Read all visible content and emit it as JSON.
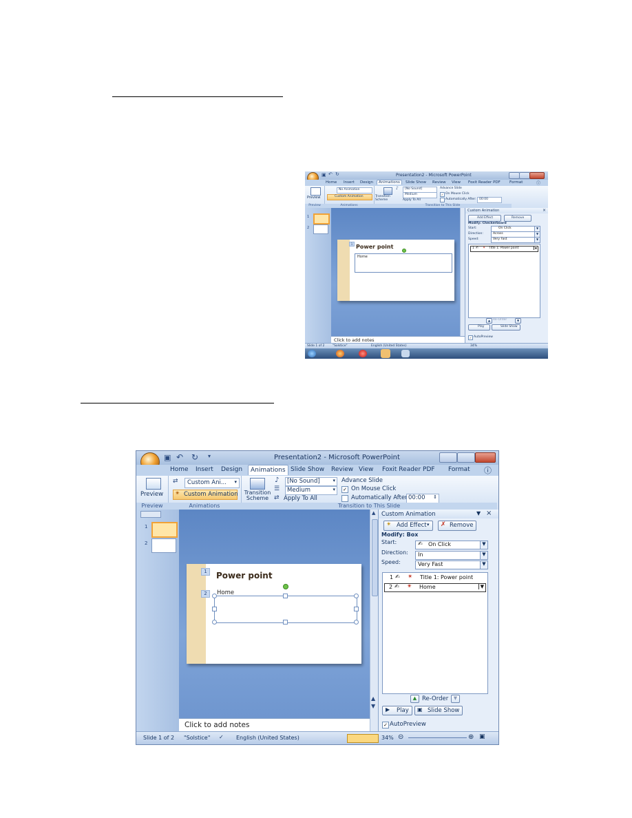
{
  "figure1": {
    "window_title": "Presentation2 - Microsoft PowerPoint",
    "tabs": [
      "Home",
      "Insert",
      "Design",
      "Animations",
      "Slide Show",
      "Review",
      "View",
      "Foxit Reader PDF",
      "Format"
    ],
    "active_tab": "Animations",
    "ribbon": {
      "preview_label": "Preview",
      "animate_value": "No Animation",
      "custom_animation_label": "Custom Animation",
      "transition_scheme_label": "Transition Scheme",
      "sound_value": "[No Sound]",
      "speed_value": "Medium",
      "apply_to_all_label": "Apply To All",
      "advance_slide_label": "Advance Slide",
      "on_mouse_click_label": "On Mouse Click",
      "auto_after_label": "Automatically After:",
      "auto_after_value": "00:00",
      "groups": [
        "Preview",
        "Animations",
        "Transition to This Slide"
      ]
    },
    "thumb_numbers": [
      "1",
      "2"
    ],
    "slide": {
      "title": "Power point",
      "body": "Home",
      "tag": "1"
    },
    "notes_placeholder": "Click to add notes",
    "task_pane": {
      "title": "Custom Animation",
      "add_effect_label": "Add Effect",
      "remove_label": "Remove",
      "modify_label": "Modify: Checkerboard",
      "start_label": "Start:",
      "start_value": "On Click",
      "direction_label": "Direction:",
      "direction_value": "Across",
      "speed_label": "Speed:",
      "speed_value": "Very Fast",
      "list": [
        {
          "num": "1",
          "text": "Title 1: Power point"
        }
      ],
      "reorder_label": "Re-Order",
      "play_label": "Play",
      "slideshow_label": "Slide Show",
      "autopreview_label": "AutoPreview"
    },
    "status": {
      "slide": "Slide 1 of 2",
      "theme": "\"Solstice\"",
      "language": "English (United States)",
      "zoom": "34%"
    }
  },
  "figure2": {
    "window_title": "Presentation2 - Microsoft PowerPoint",
    "tabs": [
      "Home",
      "Insert",
      "Design",
      "Animations",
      "Slide Show",
      "Review",
      "View",
      "Foxit Reader PDF",
      "Format"
    ],
    "active_tab": "Animations",
    "ribbon": {
      "preview_label": "Preview",
      "animate_value": "Custom Ani...",
      "custom_animation_label": "Custom Animation",
      "transition_scheme_label": "Transition Scheme",
      "sound_value": "[No Sound]",
      "speed_value": "Medium",
      "apply_to_all_label": "Apply To All",
      "advance_slide_label": "Advance Slide",
      "on_mouse_click_label": "On Mouse Click",
      "auto_after_label": "Automatically After:",
      "auto_after_value": "00:00",
      "groups": [
        "Preview",
        "Animations",
        "Transition to This Slide"
      ]
    },
    "thumb_numbers": [
      "1",
      "2"
    ],
    "slide": {
      "title": "Power point",
      "body": "Home",
      "tag1": "1",
      "tag2": "2"
    },
    "notes_placeholder": "Click to add notes",
    "task_pane": {
      "title": "Custom Animation",
      "add_effect_label": "Add Effect",
      "remove_label": "Remove",
      "modify_label": "Modify: Box",
      "start_label": "Start:",
      "start_value": "On Click",
      "direction_label": "Direction:",
      "direction_value": "In",
      "speed_label": "Speed:",
      "speed_value": "Very Fast",
      "list": [
        {
          "num": "1",
          "text": "Title 1: Power point"
        },
        {
          "num": "2",
          "text": "Home"
        }
      ],
      "reorder_label": "Re-Order",
      "play_label": "Play",
      "slideshow_label": "Slide Show",
      "autopreview_label": "AutoPreview"
    },
    "status": {
      "slide": "Slide 1 of 2",
      "theme": "\"Solstice\"",
      "language": "English (United States)",
      "zoom": "34%"
    }
  }
}
